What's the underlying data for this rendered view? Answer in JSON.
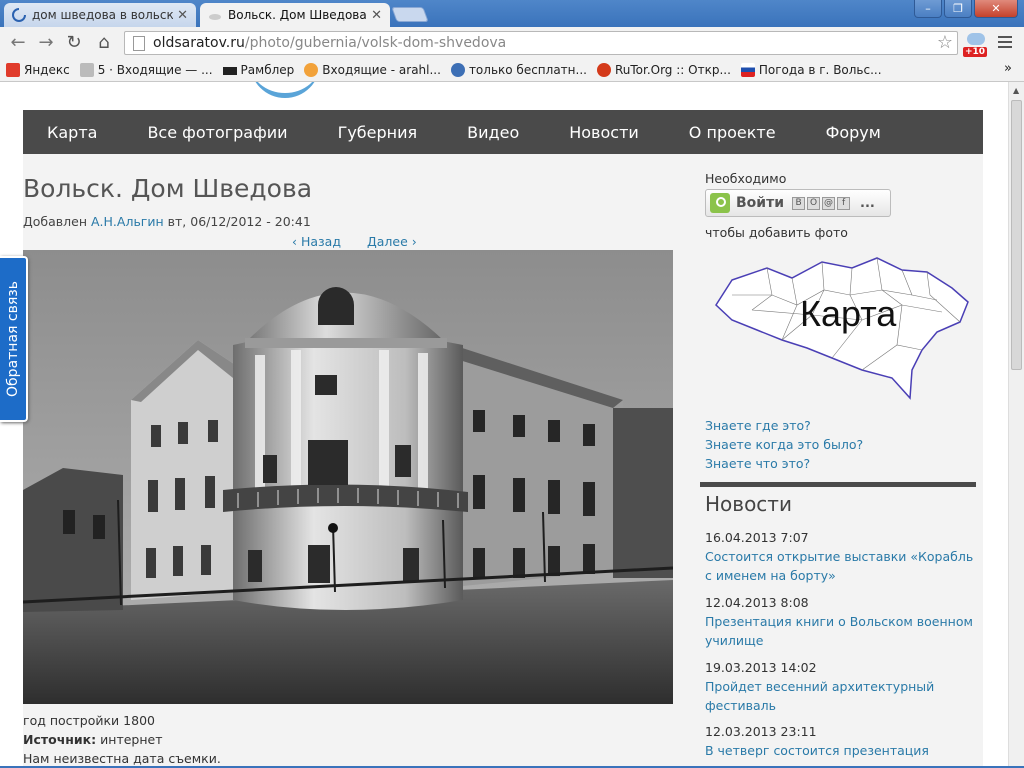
{
  "browser": {
    "tabs": [
      {
        "title": "дом шведова в вольске",
        "active": false
      },
      {
        "title": "Вольск. Дом Шведова",
        "active": true
      }
    ],
    "url": {
      "host": "oldsaratov.ru",
      "path": "/photo/gubernia/volsk-dom-shvedova"
    },
    "extension_badge": "+10",
    "bookmarks": [
      {
        "label": "Яндекс",
        "icon": "yandex-icon",
        "color": "#e03b2b"
      },
      {
        "label": "5 · Входящие — ...",
        "icon": "mail-icon",
        "color": "#aaaaaa"
      },
      {
        "label": "Рамблер",
        "icon": "home-icon",
        "color": "#222222"
      },
      {
        "label": "Входящие - arahl...",
        "icon": "mail-ru-icon",
        "color": "#2a6fc0"
      },
      {
        "label": "только бесплатн...",
        "icon": "globe-icon",
        "color": "#3d6fb5"
      },
      {
        "label": "RuTor.Org :: Откр...",
        "icon": "rutor-icon",
        "color": "#d43a1a"
      },
      {
        "label": "Погода в г. Вольс...",
        "icon": "flag-icon",
        "color": "#1f4fae"
      }
    ],
    "bookmarks_more": "»"
  },
  "nav": {
    "items": [
      "Карта",
      "Все фотографии",
      "Губерния",
      "Видео",
      "Новости",
      "О проекте",
      "Форум"
    ]
  },
  "feedback_tab": "Обратная связь",
  "article": {
    "title": "Вольск. Дом Шведова",
    "added_prefix": "Добавлен",
    "author": "А.Н.Альгин",
    "date": "вт, 06/12/2012 - 20:41",
    "prev": "‹ Назад",
    "next": "Далее ›",
    "year_built": "год постройки 1800",
    "source_label": "Источник:",
    "source_value": "интернет",
    "date_unknown": "Нам неизвестна дата съемки."
  },
  "sidebar": {
    "need_label": "Необходимо",
    "login_label": "Войти",
    "login_socials": [
      "В",
      "О",
      "@",
      "f"
    ],
    "login_more": "...",
    "add_photo_label": "чтобы добавить фото",
    "map_label": "Карта",
    "questions": [
      "Знаете где это?",
      "Знаете когда это было?",
      "Знаете что это?"
    ],
    "news_heading": "Новости",
    "news": [
      {
        "date": "16.04.2013 7:07",
        "title": "Состоится открытие выставки «Корабль с именем на борту»"
      },
      {
        "date": "12.04.2013 8:08",
        "title": "Презентация книги о Вольском военном училище"
      },
      {
        "date": "19.03.2013 14:02",
        "title": "Пройдет весенний архитектурный фестиваль"
      },
      {
        "date": "12.03.2013 23:11",
        "title": "В четверг состоится презентация"
      }
    ]
  },
  "colors": {
    "link": "#2a7aa8",
    "nav_bg": "#4a4a4a",
    "feedback_bg": "#1d6cc8",
    "chrome_blue": "#3a73bb"
  }
}
